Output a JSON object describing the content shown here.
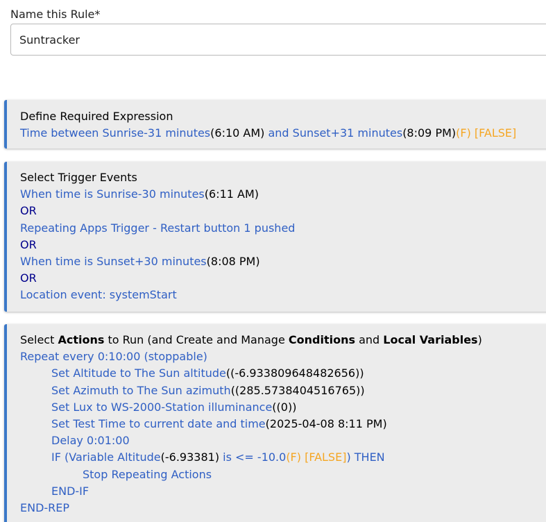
{
  "rule_name": {
    "label": "Name this Rule*",
    "value": "Suntracker"
  },
  "required_expression": {
    "header": "Define Required Expression",
    "condition_start": "Time between Sunrise-31 minutes",
    "start_time": "(6:10 AM)",
    "and_text": " and ",
    "condition_end": "Sunset+31 minutes",
    "end_time": "(8:09 PM)",
    "state_f": "(F)",
    "state_false": " [FALSE]"
  },
  "triggers": {
    "header": "Select Trigger Events",
    "or_label": "OR",
    "events": [
      {
        "text": "When time is Sunrise-30 minutes",
        "time": "(6:11 AM)"
      },
      {
        "text": "Repeating Apps Trigger - Restart button 1 pushed",
        "time": ""
      },
      {
        "text": "When time is Sunset+30 minutes",
        "time": "(8:08 PM)"
      },
      {
        "text": "Location event: systemStart",
        "time": ""
      }
    ]
  },
  "actions": {
    "header_parts": [
      "Select ",
      "Actions",
      " to Run (and Create and Manage ",
      "Conditions",
      " and ",
      "Local Variables",
      ")"
    ],
    "repeat": "Repeat every 0:10:00 (stoppable)",
    "set_altitude": {
      "text": "Set Altitude to The Sun altitude",
      "value": "((-6.933809648482656))"
    },
    "set_azimuth": {
      "text": "Set Azimuth to The Sun azimuth",
      "value": "((285.5738404516765))"
    },
    "set_lux": {
      "text": "Set Lux to WS-2000-Station illuminance",
      "value": "((0))"
    },
    "set_test_time": {
      "text": "Set Test Time to current date and time",
      "value": "(2025-04-08 8:11 PM)"
    },
    "delay": "Delay 0:01:00",
    "if_parts": {
      "start": "IF (Variable Altitude",
      "value": "(-6.93381)",
      "op": " is <= -10.0",
      "state_f": "(F)",
      "state_false": " [FALSE]",
      "end": ") THEN"
    },
    "stop": "Stop Repeating Actions",
    "end_if": "END-IF",
    "end_rep": "END-REP"
  },
  "colors": {
    "link_blue": "#2f5fc4",
    "navy": "#00008b",
    "orange": "#f5a623",
    "panel_bg": "#ececec",
    "accent_border": "#3b78c8"
  }
}
